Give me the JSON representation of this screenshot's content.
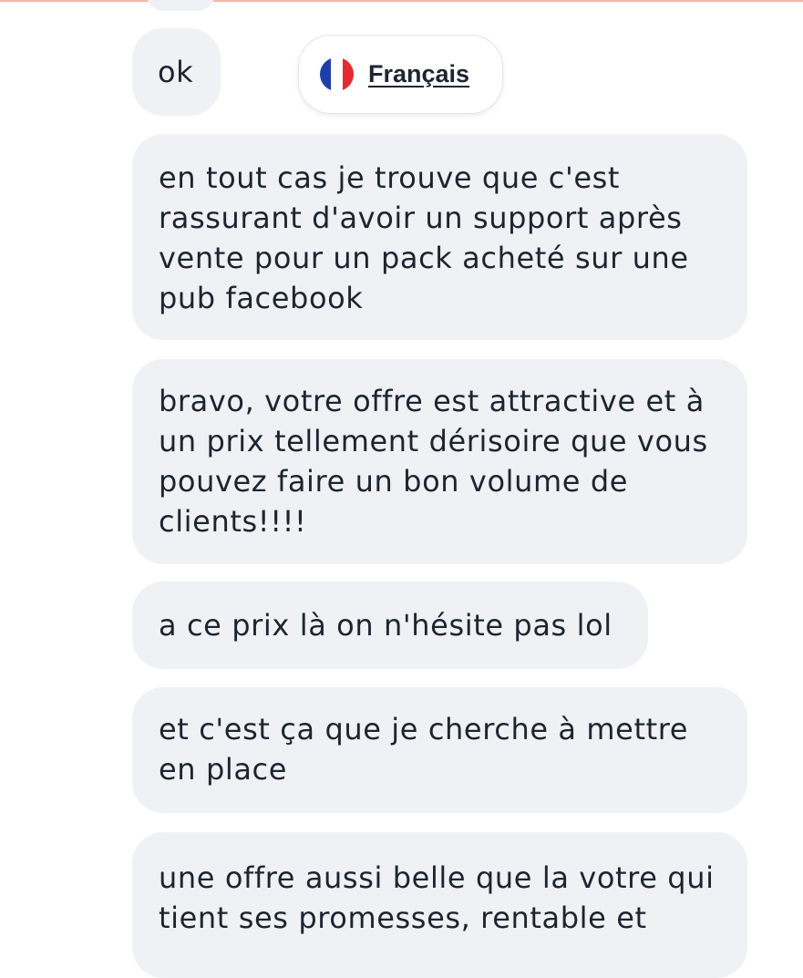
{
  "colors": {
    "bubble_bg": "#eff1f4",
    "text": "#1d2530",
    "top_border": "#f3b6a6",
    "flag_blue": "#1d3fa8",
    "flag_white": "#ffffff",
    "flag_red": "#e52a31"
  },
  "translate_chip": {
    "icon": "france-flag-icon",
    "label": "Français"
  },
  "messages": [
    {
      "text": "ok"
    },
    {
      "text": "en tout cas je trouve que c'est rassurant d'avoir un support après vente pour un pack acheté sur une pub facebook"
    },
    {
      "text": "bravo, votre offre est attractive et à un prix tellement dérisoire que vous pouvez faire un bon volume de clients!!!!"
    },
    {
      "text": "a ce prix là on n'hésite pas lol"
    },
    {
      "text": "et c'est ça que je cherche à mettre en place"
    },
    {
      "text": "une offre aussi belle que la votre qui tient ses promesses, rentable et"
    }
  ]
}
